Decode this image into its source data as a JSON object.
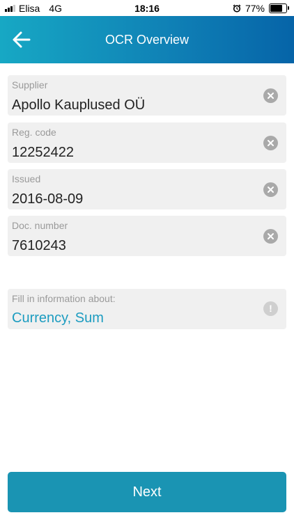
{
  "status_bar": {
    "carrier": "Elisa",
    "network": "4G",
    "time": "18:16",
    "battery": "77%",
    "battery_level": 0.77,
    "signal_bars_active": 3,
    "signal_bars_total": 4
  },
  "header": {
    "title": "OCR Overview",
    "background_colors": [
      "#17a8c4",
      "#0664a8"
    ]
  },
  "fields": [
    {
      "label": "Supplier",
      "value": "Apollo Kauplused OÜ"
    },
    {
      "label": "Reg. code",
      "value": "12252422"
    },
    {
      "label": "Issued",
      "value": "2016-08-09"
    },
    {
      "label": "Doc. number",
      "value": "7610243"
    }
  ],
  "missing_info": {
    "label": "Fill in information about:",
    "value": "Currency, Sum",
    "icon": "exclamation-icon"
  },
  "next_button": {
    "label": "Next",
    "color": "#1a94b3"
  }
}
